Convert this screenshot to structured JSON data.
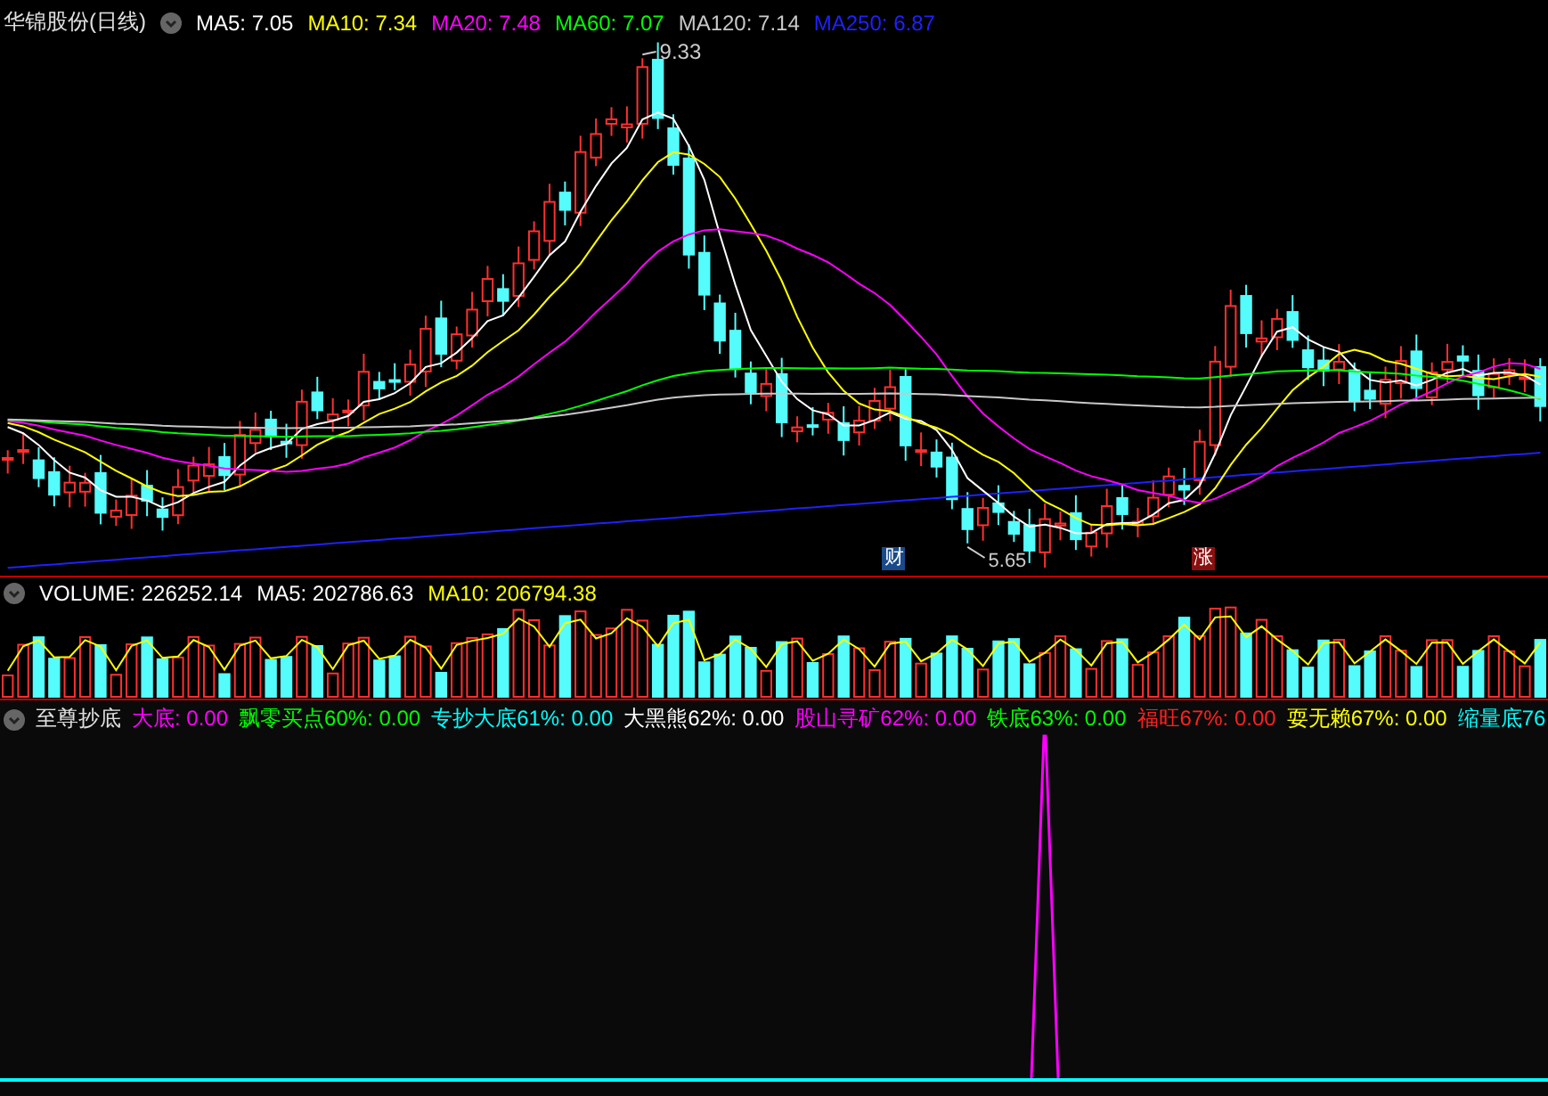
{
  "main_panel": {
    "title": "华锦股份(日线)",
    "indicators": [
      {
        "label": "MA5: 7.05",
        "color": "#ffffff"
      },
      {
        "label": "MA10: 7.34",
        "color": "#ffff00"
      },
      {
        "label": "MA20: 7.48",
        "color": "#ff00ff"
      },
      {
        "label": "MA60: 7.07",
        "color": "#00ff00"
      },
      {
        "label": "MA120: 7.14",
        "color": "#c8c8c8"
      },
      {
        "label": "MA250: 6.87",
        "color": "#2020ff"
      }
    ],
    "high_label": "9.33",
    "low_label": "5.65",
    "markers": [
      {
        "label": "财",
        "color": "#1a4a8a"
      },
      {
        "label": "涨",
        "color": "#8a1010"
      }
    ]
  },
  "volume_panel": {
    "indicators": [
      {
        "label": "VOLUME: 226252.14",
        "color": "#ffffff"
      },
      {
        "label": "MA5: 202786.63",
        "color": "#ffffff"
      },
      {
        "label": "MA10: 206794.38",
        "color": "#ffff00"
      }
    ]
  },
  "signal_panel": {
    "title": "至尊抄底",
    "indicators": [
      {
        "label": "大底: 0.00",
        "color": "#ff00ff"
      },
      {
        "label": "飘零买点60%: 0.00",
        "color": "#00ff00"
      },
      {
        "label": "专抄大底61%: 0.00",
        "color": "#00ffff"
      },
      {
        "label": "大黑熊62%: 0.00",
        "color": "#ffffff"
      },
      {
        "label": "股山寻矿62%: 0.00",
        "color": "#ff00ff"
      },
      {
        "label": "铁底63%: 0.00",
        "color": "#00ff00"
      },
      {
        "label": "福旺67%: 0.00",
        "color": "#ff2020"
      },
      {
        "label": "耍无赖67%: 0.00",
        "color": "#ffff00"
      },
      {
        "label": "缩量底76",
        "color": "#00ffff"
      }
    ]
  }
}
